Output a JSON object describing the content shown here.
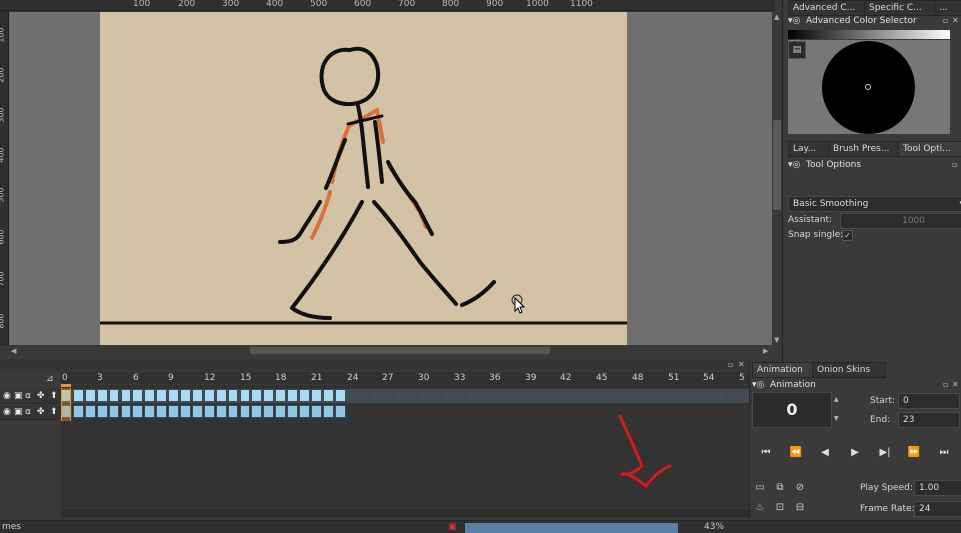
{
  "ruler": {
    "top_ticks": [
      "100",
      "200",
      "300",
      "400",
      "500",
      "600",
      "700",
      "800",
      "900",
      "1000",
      "1100"
    ],
    "left_ticks": [
      "100",
      "200",
      "300",
      "400",
      "500",
      "600",
      "700",
      "800"
    ]
  },
  "docker": {
    "tabs": [
      "Advanced C...",
      "Specific C...",
      "..."
    ],
    "color_selector_title": "Advanced Color Selector",
    "subtabs": [
      "Lay...",
      "Brush Pres...",
      "Tool Opti..."
    ],
    "tool_options_title": "Tool Options",
    "smoothing_value": "Basic Smoothing",
    "assistant_label": "Assistant:",
    "assistant_value": "1000",
    "snap_label": "Snap single:",
    "snap_check": "✓"
  },
  "timeline": {
    "frame_numbers": [
      "0",
      "3",
      "6",
      "9",
      "12",
      "15",
      "18",
      "21",
      "24",
      "27",
      "30",
      "33",
      "36",
      "39",
      "42",
      "45",
      "48",
      "51",
      "54",
      "5"
    ],
    "total_frames": 24,
    "colors": {
      "frame_fill": "#a9dbf3",
      "layer2_fill": "#8fc7e8",
      "empty": "#444b52",
      "playhead": "#e79a2a"
    }
  },
  "animation": {
    "tabs": [
      "Animation",
      "Onion Skins"
    ],
    "title": "Animation",
    "current_frame": "0",
    "start_label": "Start:",
    "start_value": "0",
    "end_label": "End:",
    "end_value": "23",
    "play_speed_label": "Play Speed:",
    "play_speed_value": "1.00",
    "frame_rate_label": "Frame Rate:",
    "frame_rate_value": "24"
  },
  "status": {
    "left_text": "mes",
    "zoom": "43%"
  }
}
